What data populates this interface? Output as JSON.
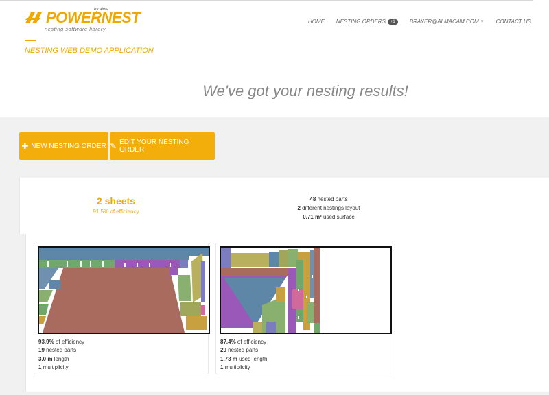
{
  "nav": {
    "logo_text_power": "POWER",
    "logo_text_nest": "NEST",
    "logo_by": "by alma",
    "logo_sub": "nesting software library",
    "links": [
      {
        "label": "HOME"
      },
      {
        "label": "NESTING ORDERS",
        "badge": "+1"
      },
      {
        "label": "BRAYER@ALMACAM.COM"
      },
      {
        "label": "CONTACT US"
      }
    ]
  },
  "app_title": "NESTING WEB DEMO APPLICATION",
  "hero": "We've got your nesting results!",
  "buttons": {
    "new_order": "NEW NESTING ORDER",
    "edit_order": "EDIT YOUR NESTING ORDER"
  },
  "summary": {
    "sheets": "2 sheets",
    "efficiency": "91.5% of efficiency",
    "nested_parts_value": "48",
    "nested_parts_label": "nested parts",
    "layouts_value": "2",
    "layouts_label": "different nestings layout",
    "surface_value": "0.71 m²",
    "surface_label": "used surface"
  },
  "sheets": [
    {
      "efficiency_value": "93.9%",
      "efficiency_label": "of efficiency",
      "parts_value": "19",
      "parts_label": "nested parts",
      "length_value": "3.0 m",
      "length_label": "length",
      "multiplicity_value": "1",
      "multiplicity_label": "multiplicity"
    },
    {
      "efficiency_value": "87.4%",
      "efficiency_label": "of efficiency",
      "parts_value": "29",
      "parts_label": "nested parts",
      "length_value": "1.73 m",
      "length_label": "used length",
      "multiplicity_value": "1",
      "multiplicity_label": "multiplicity"
    }
  ],
  "colors": {
    "accent": "#f4ae0c",
    "parts": [
      "#a86b5e",
      "#6fa86a",
      "#9a59b8",
      "#5e86a6",
      "#b8b05c",
      "#c8a040",
      "#d06a9a",
      "#7c7cc0",
      "#8ab070",
      "#a0a65a",
      "#7090b0"
    ]
  },
  "icons": {
    "new_order": "plus-icon",
    "edit_order": "pencil-icon",
    "caret": "caret-down-icon"
  }
}
